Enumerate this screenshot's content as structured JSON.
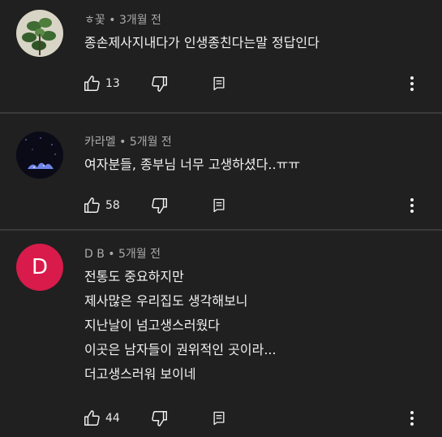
{
  "colors": {
    "background": "#202020",
    "divider": "#3a3a3a",
    "avatar_d": "#d81b4a"
  },
  "comments": [
    {
      "author": "ㅎ꽃",
      "time": "3개월 전",
      "lines": [
        "종손제사지내다가 인생종친다는말 정답인다"
      ],
      "likes": "13",
      "avatar": "plant-photo"
    },
    {
      "author": "카라멜",
      "time": "5개월 전",
      "lines": [
        "여자분들, 종부님 너무 고생하셨다..ㅠㅠ"
      ],
      "likes": "58",
      "avatar": "night-sky-photo"
    },
    {
      "author": "D B",
      "time": "5개월 전",
      "lines": [
        "전통도 중요하지만",
        "제사많은  우리집도  생각해보니",
        "지난날이 넘고생스러웠다",
        "이곳은 남자들이 권위적인 곳이라...",
        "더고생스러워 보이네"
      ],
      "likes": "44",
      "avatar_letter": "D"
    }
  ],
  "separator": "•",
  "icons": [
    "like-icon",
    "dislike-icon",
    "reply-icon",
    "more-vert-icon"
  ]
}
